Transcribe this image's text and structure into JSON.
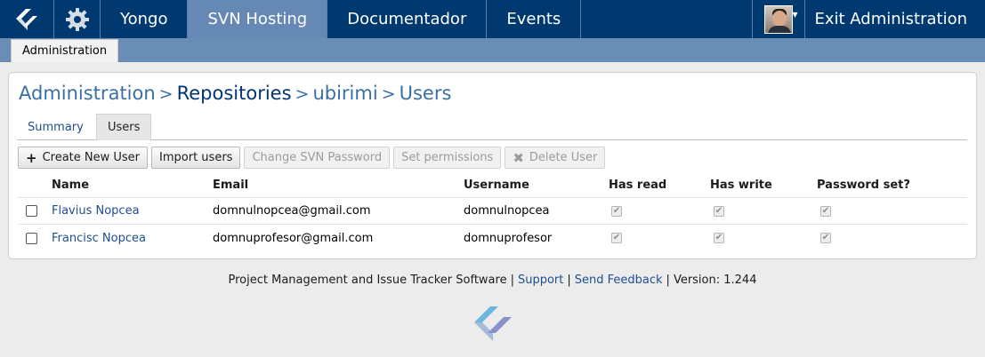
{
  "nav": {
    "items": [
      {
        "label": "Yongo",
        "active": false
      },
      {
        "label": "SVN Hosting",
        "active": true
      },
      {
        "label": "Documentador",
        "active": false
      },
      {
        "label": "Events",
        "active": false
      }
    ],
    "exit_label": "Exit Administration"
  },
  "subnav": {
    "tab": "Administration"
  },
  "breadcrumb": {
    "b0": "Administration",
    "b1": "Repositories",
    "b2": "ubirimi",
    "b3": "Users",
    "sep": ">"
  },
  "tabs": {
    "summary": "Summary",
    "users": "Users"
  },
  "toolbar": {
    "create": "Create New User",
    "import": "Import users",
    "change_pw": "Change SVN Password",
    "perms": "Set permissions",
    "delete": "Delete User"
  },
  "table": {
    "headers": {
      "name": "Name",
      "email": "Email",
      "username": "Username",
      "read": "Has read",
      "write": "Has write",
      "password": "Password set?"
    },
    "rows": [
      {
        "name": "Flavius Nopcea",
        "email": "domnulnopcea@gmail.com",
        "username": "domnulnopcea",
        "read": true,
        "write": true,
        "password": true
      },
      {
        "name": "Francisc Nopcea",
        "email": "domnuprofesor@gmail.com",
        "username": "domnuprofesor",
        "read": true,
        "write": true,
        "password": true
      }
    ]
  },
  "footer": {
    "text": "Project Management and Issue Tracker Software",
    "support": "Support",
    "feedback": "Send Feedback",
    "version": "Version: 1.244",
    "sep": "|"
  },
  "colors": {
    "nav_bg": "#003870",
    "nav_active": "#6589b4",
    "subnav_bg": "#6a8db6",
    "link": "#1d4f8f"
  }
}
